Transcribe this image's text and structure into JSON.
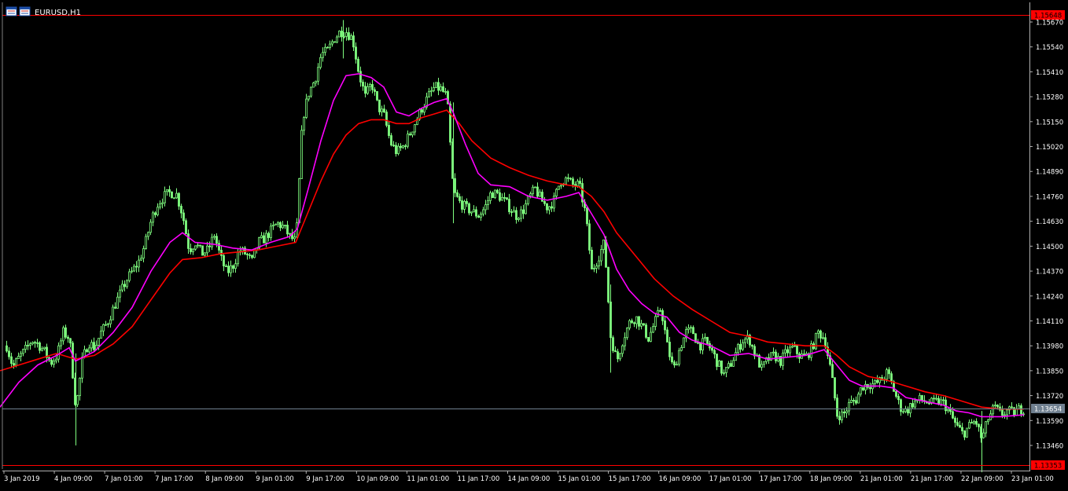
{
  "window": {
    "title": "EURUSD,H1",
    "icon": "chart-window-icon"
  },
  "colors": {
    "background": "#000000",
    "frame": "#808080",
    "axis_text": "#ffffff",
    "candle": "#80ff80",
    "ma_fast": "#ff00ff",
    "ma_slow": "#ff0000",
    "level_line": "#ff0000",
    "bid_line": "#708090",
    "level_tag_bg": "#ff0000",
    "bid_tag_bg": "#708090"
  },
  "chart_data": {
    "type": "candlestick",
    "symbol": "EURUSD",
    "timeframe": "H1",
    "ylim": [
      1.13293,
      1.15725
    ],
    "y_ticks": [
      "1.15670",
      "1.15540",
      "1.15410",
      "1.15280",
      "1.15150",
      "1.15020",
      "1.14890",
      "1.14760",
      "1.14630",
      "1.14500",
      "1.14370",
      "1.14240",
      "1.14110",
      "1.13980",
      "1.13850",
      "1.13720",
      "1.13590",
      "1.13460"
    ],
    "x_ticks": [
      "3 Jan 2019",
      "4 Jan 09:00",
      "7 Jan 01:00",
      "7 Jan 17:00",
      "8 Jan 09:00",
      "9 Jan 01:00",
      "9 Jan 17:00",
      "10 Jan 09:00",
      "11 Jan 01:00",
      "11 Jan 17:00",
      "14 Jan 09:00",
      "15 Jan 01:00",
      "15 Jan 17:00",
      "16 Jan 09:00",
      "17 Jan 01:00",
      "17 Jan 17:00",
      "18 Jan 09:00",
      "21 Jan 01:00",
      "21 Jan 17:00",
      "22 Jan 09:00",
      "23 Jan 01:00"
    ],
    "price_levels": [
      {
        "label": "1.15648",
        "value": 1.15648
      },
      {
        "label": "1.13353",
        "value": 1.13353
      }
    ],
    "bid": {
      "label": "1.13654",
      "value": 1.13654
    },
    "close_path": [
      [
        0,
        1.1385
      ],
      [
        8,
        1.1398
      ],
      [
        16,
        1.1387
      ],
      [
        24,
        1.1392
      ],
      [
        32,
        1.1396
      ],
      [
        40,
        1.1401
      ],
      [
        48,
        1.1399
      ],
      [
        56,
        1.1395
      ],
      [
        64,
        1.1389
      ],
      [
        72,
        1.1393
      ],
      [
        80,
        1.1405
      ],
      [
        88,
        1.1402
      ],
      [
        96,
        1.1365
      ],
      [
        104,
        1.139
      ],
      [
        112,
        1.14
      ],
      [
        120,
        1.1397
      ],
      [
        128,
        1.1405
      ],
      [
        136,
        1.141
      ],
      [
        144,
        1.1418
      ],
      [
        152,
        1.1425
      ],
      [
        160,
        1.1432
      ],
      [
        168,
        1.1437
      ],
      [
        176,
        1.1442
      ],
      [
        184,
        1.1451
      ],
      [
        192,
        1.1464
      ],
      [
        200,
        1.1472
      ],
      [
        208,
        1.1476
      ],
      [
        216,
        1.1478
      ],
      [
        224,
        1.1477
      ],
      [
        232,
        1.1466
      ],
      [
        240,
        1.1448
      ],
      [
        248,
        1.1452
      ],
      [
        256,
        1.1446
      ],
      [
        264,
        1.1448
      ],
      [
        272,
        1.1456
      ],
      [
        280,
        1.1444
      ],
      [
        288,
        1.1436
      ],
      [
        296,
        1.144
      ],
      [
        304,
        1.1448
      ],
      [
        312,
        1.1446
      ],
      [
        320,
        1.1442
      ],
      [
        328,
        1.1452
      ],
      [
        336,
        1.1454
      ],
      [
        344,
        1.1458
      ],
      [
        352,
        1.1462
      ],
      [
        360,
        1.146
      ],
      [
        368,
        1.1455
      ],
      [
        376,
        1.1452
      ],
      [
        384,
        1.1516
      ],
      [
        392,
        1.153
      ],
      [
        400,
        1.1537
      ],
      [
        408,
        1.155
      ],
      [
        416,
        1.1552
      ],
      [
        424,
        1.1558
      ],
      [
        432,
        1.1562
      ],
      [
        440,
        1.1562
      ],
      [
        448,
        1.1558
      ],
      [
        456,
        1.154
      ],
      [
        464,
        1.1528
      ],
      [
        472,
        1.1535
      ],
      [
        480,
        1.1523
      ],
      [
        488,
        1.1518
      ],
      [
        496,
        1.1504
      ],
      [
        504,
        1.1499
      ],
      [
        512,
        1.1502
      ],
      [
        520,
        1.1508
      ],
      [
        528,
        1.1515
      ],
      [
        536,
        1.1522
      ],
      [
        544,
        1.1528
      ],
      [
        552,
        1.1533
      ],
      [
        560,
        1.1532
      ],
      [
        568,
        1.1528
      ],
      [
        576,
        1.1478
      ],
      [
        584,
        1.1473
      ],
      [
        592,
        1.147
      ],
      [
        600,
        1.1468
      ],
      [
        608,
        1.1466
      ],
      [
        616,
        1.147
      ],
      [
        624,
        1.1478
      ],
      [
        632,
        1.1477
      ],
      [
        640,
        1.1474
      ],
      [
        648,
        1.147
      ],
      [
        656,
        1.1466
      ],
      [
        664,
        1.1468
      ],
      [
        672,
        1.1475
      ],
      [
        680,
        1.148
      ],
      [
        688,
        1.1474
      ],
      [
        696,
        1.147
      ],
      [
        704,
        1.1474
      ],
      [
        712,
        1.1484
      ],
      [
        720,
        1.1485
      ],
      [
        728,
        1.1482
      ],
      [
        736,
        1.1482
      ],
      [
        744,
        1.1467
      ],
      [
        752,
        1.1437
      ],
      [
        760,
        1.1444
      ],
      [
        768,
        1.1452
      ],
      [
        776,
        1.1403
      ],
      [
        784,
        1.139
      ],
      [
        792,
        1.1402
      ],
      [
        800,
        1.141
      ],
      [
        808,
        1.1413
      ],
      [
        816,
        1.1408
      ],
      [
        824,
        1.1402
      ],
      [
        832,
        1.141
      ],
      [
        840,
        1.1418
      ],
      [
        848,
        1.1398
      ],
      [
        856,
        1.1385
      ],
      [
        864,
        1.1397
      ],
      [
        872,
        1.1405
      ],
      [
        880,
        1.1406
      ],
      [
        888,
        1.1398
      ],
      [
        896,
        1.14
      ],
      [
        904,
        1.1396
      ],
      [
        912,
        1.1389
      ],
      [
        920,
        1.1383
      ],
      [
        928,
        1.1388
      ],
      [
        936,
        1.1395
      ],
      [
        944,
        1.1401
      ],
      [
        952,
        1.1402
      ],
      [
        960,
        1.1393
      ],
      [
        968,
        1.1386
      ],
      [
        976,
        1.1391
      ],
      [
        984,
        1.1393
      ],
      [
        992,
        1.139
      ],
      [
        1000,
        1.1395
      ],
      [
        1008,
        1.1397
      ],
      [
        1016,
        1.1393
      ],
      [
        1024,
        1.1392
      ],
      [
        1032,
        1.1397
      ],
      [
        1040,
        1.1405
      ],
      [
        1048,
        1.1402
      ],
      [
        1056,
        1.1385
      ],
      [
        1064,
        1.1362
      ],
      [
        1072,
        1.1362
      ],
      [
        1080,
        1.1368
      ],
      [
        1088,
        1.137
      ],
      [
        1096,
        1.1377
      ],
      [
        1104,
        1.1378
      ],
      [
        1112,
        1.1378
      ],
      [
        1120,
        1.138
      ],
      [
        1128,
        1.1384
      ],
      [
        1136,
        1.1375
      ],
      [
        1144,
        1.1366
      ],
      [
        1152,
        1.1364
      ],
      [
        1160,
        1.1368
      ],
      [
        1168,
        1.137
      ],
      [
        1176,
        1.1369
      ],
      [
        1184,
        1.1368
      ],
      [
        1192,
        1.1369
      ],
      [
        1200,
        1.1368
      ],
      [
        1208,
        1.1362
      ],
      [
        1216,
        1.1356
      ],
      [
        1224,
        1.1352
      ],
      [
        1232,
        1.1356
      ],
      [
        1240,
        1.1359
      ],
      [
        1248,
        1.1349
      ],
      [
        1256,
        1.136
      ],
      [
        1264,
        1.1366
      ],
      [
        1272,
        1.1362
      ],
      [
        1280,
        1.1364
      ],
      [
        1288,
        1.1363
      ],
      [
        1296,
        1.1365
      ],
      [
        1302,
        1.1365
      ]
    ],
    "ma_fast_path": [
      [
        0,
        1.1366
      ],
      [
        24,
        1.1379
      ],
      [
        48,
        1.1388
      ],
      [
        72,
        1.1393
      ],
      [
        88,
        1.1397
      ],
      [
        96,
        1.139
      ],
      [
        120,
        1.1395
      ],
      [
        144,
        1.1405
      ],
      [
        168,
        1.1418
      ],
      [
        192,
        1.1437
      ],
      [
        216,
        1.1452
      ],
      [
        232,
        1.1457
      ],
      [
        248,
        1.1452
      ],
      [
        272,
        1.1451
      ],
      [
        296,
        1.1449
      ],
      [
        320,
        1.1448
      ],
      [
        344,
        1.1452
      ],
      [
        368,
        1.1455
      ],
      [
        378,
        1.1459
      ],
      [
        392,
        1.148
      ],
      [
        408,
        1.1505
      ],
      [
        424,
        1.1526
      ],
      [
        440,
        1.1539
      ],
      [
        456,
        1.154
      ],
      [
        472,
        1.1538
      ],
      [
        488,
        1.1533
      ],
      [
        504,
        1.152
      ],
      [
        520,
        1.1518
      ],
      [
        536,
        1.1522
      ],
      [
        552,
        1.1525
      ],
      [
        568,
        1.1527
      ],
      [
        576,
        1.152
      ],
      [
        592,
        1.1503
      ],
      [
        608,
        1.1488
      ],
      [
        624,
        1.1482
      ],
      [
        648,
        1.1481
      ],
      [
        672,
        1.1476
      ],
      [
        696,
        1.1474
      ],
      [
        720,
        1.1476
      ],
      [
        736,
        1.1478
      ],
      [
        752,
        1.1467
      ],
      [
        768,
        1.1456
      ],
      [
        784,
        1.1438
      ],
      [
        800,
        1.1427
      ],
      [
        816,
        1.142
      ],
      [
        832,
        1.1415
      ],
      [
        848,
        1.1413
      ],
      [
        864,
        1.1405
      ],
      [
        880,
        1.1401
      ],
      [
        904,
        1.1398
      ],
      [
        928,
        1.1393
      ],
      [
        952,
        1.1394
      ],
      [
        976,
        1.1391
      ],
      [
        1000,
        1.1392
      ],
      [
        1024,
        1.1393
      ],
      [
        1048,
        1.1396
      ],
      [
        1064,
        1.1388
      ],
      [
        1080,
        1.138
      ],
      [
        1096,
        1.1377
      ],
      [
        1120,
        1.1377
      ],
      [
        1136,
        1.1376
      ],
      [
        1152,
        1.1371
      ],
      [
        1176,
        1.1369
      ],
      [
        1200,
        1.1367
      ],
      [
        1216,
        1.1364
      ],
      [
        1232,
        1.1363
      ],
      [
        1248,
        1.1361
      ],
      [
        1272,
        1.1361
      ],
      [
        1302,
        1.1362
      ]
    ],
    "ma_slow_path": [
      [
        0,
        1.1385
      ],
      [
        24,
        1.1388
      ],
      [
        48,
        1.1391
      ],
      [
        72,
        1.1394
      ],
      [
        96,
        1.1391
      ],
      [
        120,
        1.1393
      ],
      [
        144,
        1.1399
      ],
      [
        168,
        1.1408
      ],
      [
        192,
        1.1422
      ],
      [
        216,
        1.1436
      ],
      [
        232,
        1.1443
      ],
      [
        256,
        1.1444
      ],
      [
        280,
        1.1446
      ],
      [
        304,
        1.1447
      ],
      [
        328,
        1.1448
      ],
      [
        352,
        1.145
      ],
      [
        376,
        1.1452
      ],
      [
        392,
        1.1468
      ],
      [
        408,
        1.1484
      ],
      [
        424,
        1.1498
      ],
      [
        440,
        1.1508
      ],
      [
        456,
        1.1514
      ],
      [
        472,
        1.1516
      ],
      [
        488,
        1.1516
      ],
      [
        504,
        1.1514
      ],
      [
        520,
        1.1514
      ],
      [
        536,
        1.1517
      ],
      [
        552,
        1.1519
      ],
      [
        568,
        1.1521
      ],
      [
        584,
        1.1514
      ],
      [
        600,
        1.1505
      ],
      [
        624,
        1.1496
      ],
      [
        648,
        1.1491
      ],
      [
        672,
        1.1487
      ],
      [
        696,
        1.1484
      ],
      [
        720,
        1.1482
      ],
      [
        736,
        1.1481
      ],
      [
        752,
        1.1476
      ],
      [
        768,
        1.1468
      ],
      [
        784,
        1.1457
      ],
      [
        808,
        1.1445
      ],
      [
        832,
        1.1433
      ],
      [
        856,
        1.1424
      ],
      [
        880,
        1.1417
      ],
      [
        904,
        1.1411
      ],
      [
        928,
        1.1405
      ],
      [
        952,
        1.1403
      ],
      [
        976,
        1.14
      ],
      [
        1000,
        1.1399
      ],
      [
        1024,
        1.1398
      ],
      [
        1048,
        1.1398
      ],
      [
        1064,
        1.1393
      ],
      [
        1080,
        1.1387
      ],
      [
        1104,
        1.1382
      ],
      [
        1128,
        1.138
      ],
      [
        1152,
        1.1377
      ],
      [
        1176,
        1.1374
      ],
      [
        1200,
        1.1372
      ],
      [
        1224,
        1.1369
      ],
      [
        1248,
        1.1366
      ],
      [
        1272,
        1.1365
      ],
      [
        1302,
        1.1365
      ]
    ]
  }
}
